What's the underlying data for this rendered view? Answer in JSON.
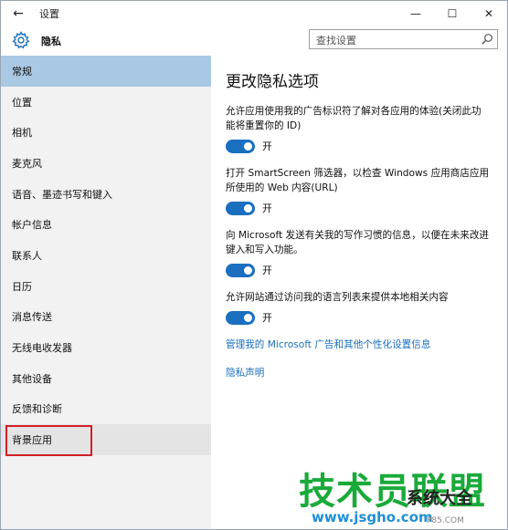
{
  "window": {
    "title": "设置",
    "back_icon": "←",
    "controls": {
      "minimize": "—",
      "maximize": "☐",
      "close": "✕"
    }
  },
  "header": {
    "section_title": "隐私",
    "search_placeholder": "查找设置"
  },
  "sidebar": {
    "items": [
      {
        "label": "常规"
      },
      {
        "label": "位置"
      },
      {
        "label": "相机"
      },
      {
        "label": "麦克风"
      },
      {
        "label": "语音、墨迹书写和键入"
      },
      {
        "label": "帐户信息"
      },
      {
        "label": "联系人"
      },
      {
        "label": "日历"
      },
      {
        "label": "消息传送"
      },
      {
        "label": "无线电收发器"
      },
      {
        "label": "其他设备"
      },
      {
        "label": "反馈和诊断"
      },
      {
        "label": "背景应用"
      }
    ],
    "selected_index": 0,
    "highlighted_index": 12
  },
  "main": {
    "title": "更改隐私选项",
    "options": [
      {
        "desc": "允许应用使用我的广告标识符了解对各应用的体验(关闭此功能将重置你的 ID)",
        "state": "开"
      },
      {
        "desc": "打开 SmartScreen 筛选器，以检查 Windows 应用商店应用所使用的 Web 内容(URL)",
        "state": "开"
      },
      {
        "desc": "向 Microsoft 发送有关我的写作习惯的信息，以便在未来改进键入和写入功能。",
        "state": "开"
      },
      {
        "desc": "允许网站通过访问我的语言列表来提供本地相关内容",
        "state": "开"
      }
    ],
    "links": {
      "manage": "管理我的 Microsoft 广告和其他个性化设置信息",
      "privacy": "隐私声明"
    }
  },
  "watermark": {
    "big": "技术员联盟",
    "small": "系统大全",
    "url": "www.jsgho.com",
    "extra": "P85.COM"
  },
  "colors": {
    "accent": "#1a6fbe",
    "selected_bg": "#a9c8e4",
    "sidebar_bg": "#f2f2f2",
    "highlight_border": "#d21f26"
  }
}
